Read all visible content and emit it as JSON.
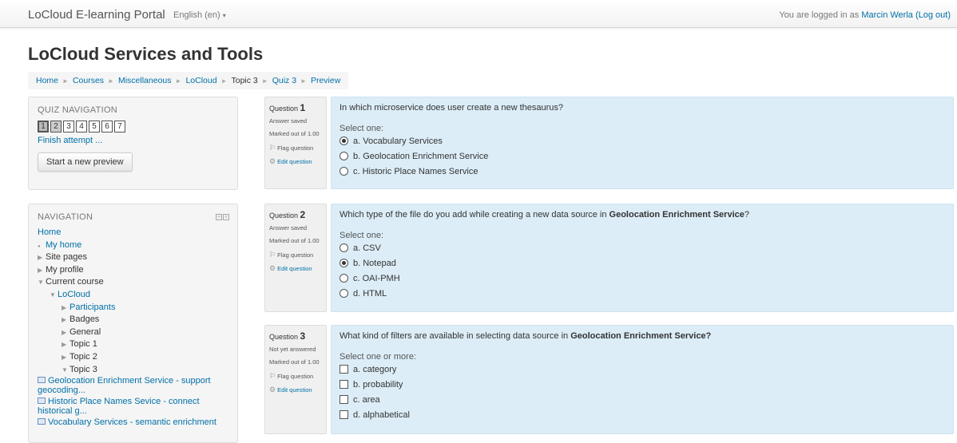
{
  "navbar": {
    "brand": "LoCloud E-learning Portal",
    "language": "English (en)",
    "login_prefix": "You are logged in as",
    "user_name": "Marcin Werla",
    "logout": "(Log out)"
  },
  "page": {
    "title": "LoCloud Services and Tools"
  },
  "breadcrumb": [
    {
      "label": "Home",
      "link": true
    },
    {
      "label": "Courses",
      "link": true
    },
    {
      "label": "Miscellaneous",
      "link": true
    },
    {
      "label": "LoCloud",
      "link": true
    },
    {
      "label": "Topic 3",
      "link": false
    },
    {
      "label": "Quiz 3",
      "link": true
    },
    {
      "label": "Preview",
      "link": true
    }
  ],
  "quiz_nav": {
    "title": "QUIZ NAVIGATION",
    "buttons": [
      "1",
      "2",
      "3",
      "4",
      "5",
      "6",
      "7"
    ],
    "finish": "Finish attempt ...",
    "preview_button": "Start a new preview"
  },
  "navigation": {
    "title": "NAVIGATION",
    "items": [
      {
        "label": "Home",
        "link": true,
        "depth": 0,
        "icon": "none"
      },
      {
        "label": "My home",
        "link": true,
        "depth": 1,
        "icon": "bullet"
      },
      {
        "label": "Site pages",
        "link": false,
        "depth": 1,
        "icon": "collapsed"
      },
      {
        "label": "My profile",
        "link": false,
        "depth": 1,
        "icon": "collapsed"
      },
      {
        "label": "Current course",
        "link": false,
        "depth": 1,
        "icon": "expanded"
      },
      {
        "label": "LoCloud",
        "link": true,
        "depth": 2,
        "icon": "expanded"
      },
      {
        "label": "Participants",
        "link": true,
        "depth": 3,
        "icon": "collapsed"
      },
      {
        "label": "Badges",
        "link": false,
        "depth": 3,
        "icon": "collapsed"
      },
      {
        "label": "General",
        "link": false,
        "depth": 3,
        "icon": "collapsed"
      },
      {
        "label": "Topic 1",
        "link": false,
        "depth": 3,
        "icon": "collapsed"
      },
      {
        "label": "Topic 2",
        "link": false,
        "depth": 3,
        "icon": "collapsed"
      },
      {
        "label": "Topic 3",
        "link": false,
        "depth": 3,
        "icon": "expanded"
      },
      {
        "label": "Geolocation Enrichment Service - support geocoding...",
        "link": true,
        "depth": 4,
        "icon": "resource"
      },
      {
        "label": "Historic Place Names Sevice - connect historical g...",
        "link": true,
        "depth": 4,
        "icon": "resource"
      },
      {
        "label": "Vocabulary Services - semantic enrichment",
        "link": true,
        "depth": 4,
        "icon": "resource"
      }
    ]
  },
  "questions": [
    {
      "label": "Question",
      "number": "1",
      "state": "Answer saved",
      "marked": "Marked out of 1.00",
      "flag": "Flag question",
      "edit": "Edit question",
      "text_before": "In which microservice does user create a new thesaurus?",
      "text_bold": "",
      "text_after": "",
      "prompt": "Select one:",
      "type": "radio",
      "options": [
        {
          "label": "a. Vocabulary Services",
          "selected": true
        },
        {
          "label": "b. Geolocation Enrichment Service",
          "selected": false
        },
        {
          "label": "c. Historic Place Names Service",
          "selected": false
        }
      ]
    },
    {
      "label": "Question",
      "number": "2",
      "state": "Answer saved",
      "marked": "Marked out of 1.00",
      "flag": "Flag question",
      "edit": "Edit question",
      "text_before": "Which type of the file do you add while creating a new data source in ",
      "text_bold": "Geolocation Enrichment Service",
      "text_after": "?",
      "prompt": "Select one:",
      "type": "radio",
      "options": [
        {
          "label": "a. CSV",
          "selected": false
        },
        {
          "label": "b. Notepad",
          "selected": true
        },
        {
          "label": "c. OAI-PMH",
          "selected": false
        },
        {
          "label": "d. HTML",
          "selected": false
        }
      ]
    },
    {
      "label": "Question",
      "number": "3",
      "state": "Not yet answered",
      "marked": "Marked out of 1.00",
      "flag": "Flag question",
      "edit": "Edit question",
      "text_before": "What kind of filters are available in selecting data source in ",
      "text_bold": "Geolocation Enrichment Service?",
      "text_after": "",
      "prompt": "Select one or more:",
      "type": "checkbox",
      "options": [
        {
          "label": "a. category",
          "selected": false
        },
        {
          "label": "b. probability",
          "selected": false
        },
        {
          "label": "c. area",
          "selected": false
        },
        {
          "label": "d. alphabetical",
          "selected": false
        }
      ]
    }
  ]
}
